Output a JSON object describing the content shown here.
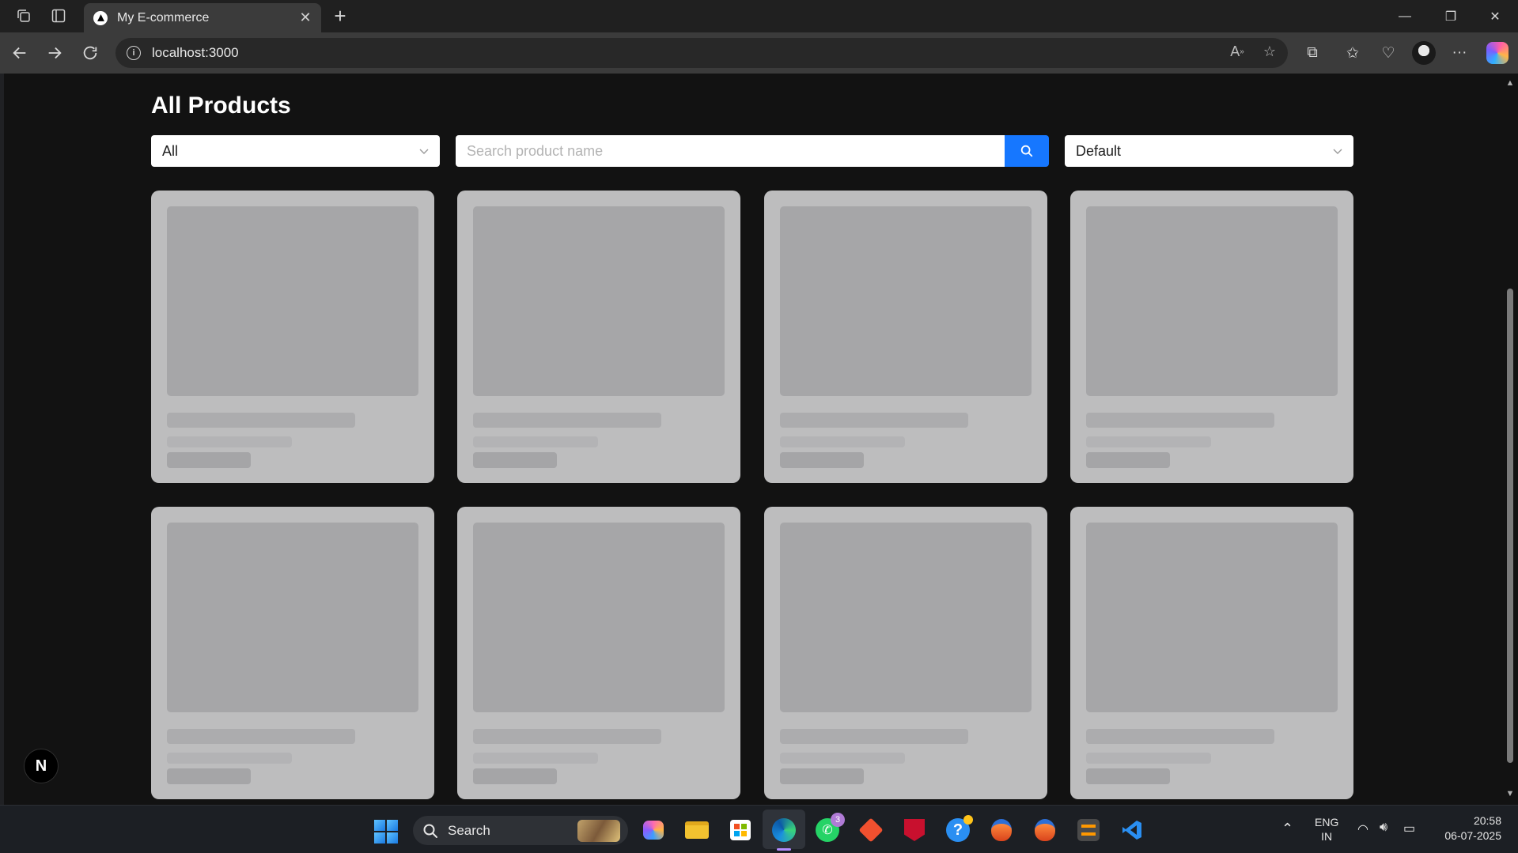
{
  "browser": {
    "tab_title": "My E-commerce",
    "tab_close": "✕",
    "new_tab": "+",
    "url": "localhost:3000",
    "window_controls": {
      "minimize": "—",
      "restore": "❐",
      "close": "✕"
    }
  },
  "page": {
    "title": "All Products",
    "category_filter": {
      "selected": "All"
    },
    "search": {
      "placeholder": "Search product name",
      "value": ""
    },
    "sort": {
      "selected": "Default"
    },
    "product_grid": {
      "state": "loading skeletons",
      "rows": 2,
      "columns": 4
    },
    "dev_badge": "N"
  },
  "colors": {
    "page_bg": "#121212",
    "accent": "#1677ff",
    "skeleton_card": "#bdbdbe",
    "skeleton_block": "#a6a6a8"
  },
  "taskbar": {
    "search_label": "Search",
    "whatsapp_badge": "3",
    "language_top": "ENG",
    "language_bottom": "IN",
    "time": "20:58",
    "date": "06-07-2025",
    "pinned_icons": [
      "copilot-icon",
      "file-explorer-icon",
      "microsoft-store-icon",
      "edge-icon",
      "whatsapp-icon",
      "git-icon",
      "mcafee-icon",
      "help-icon",
      "app-icon",
      "app-icon",
      "sublime-icon",
      "vscode-icon"
    ]
  }
}
